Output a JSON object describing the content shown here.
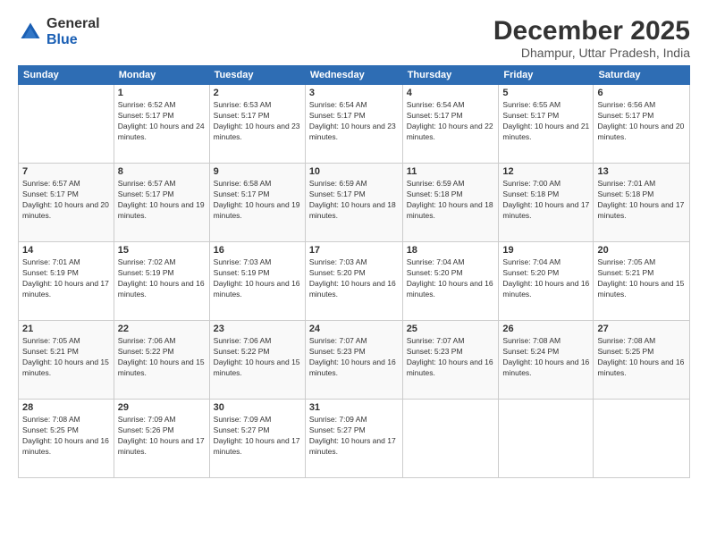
{
  "logo": {
    "general": "General",
    "blue": "Blue"
  },
  "title": "December 2025",
  "subtitle": "Dhampur, Uttar Pradesh, India",
  "days": [
    "Sunday",
    "Monday",
    "Tuesday",
    "Wednesday",
    "Thursday",
    "Friday",
    "Saturday"
  ],
  "weeks": [
    [
      {
        "num": "",
        "sunrise": "",
        "sunset": "",
        "daylight": ""
      },
      {
        "num": "1",
        "sunrise": "Sunrise: 6:52 AM",
        "sunset": "Sunset: 5:17 PM",
        "daylight": "Daylight: 10 hours and 24 minutes."
      },
      {
        "num": "2",
        "sunrise": "Sunrise: 6:53 AM",
        "sunset": "Sunset: 5:17 PM",
        "daylight": "Daylight: 10 hours and 23 minutes."
      },
      {
        "num": "3",
        "sunrise": "Sunrise: 6:54 AM",
        "sunset": "Sunset: 5:17 PM",
        "daylight": "Daylight: 10 hours and 23 minutes."
      },
      {
        "num": "4",
        "sunrise": "Sunrise: 6:54 AM",
        "sunset": "Sunset: 5:17 PM",
        "daylight": "Daylight: 10 hours and 22 minutes."
      },
      {
        "num": "5",
        "sunrise": "Sunrise: 6:55 AM",
        "sunset": "Sunset: 5:17 PM",
        "daylight": "Daylight: 10 hours and 21 minutes."
      },
      {
        "num": "6",
        "sunrise": "Sunrise: 6:56 AM",
        "sunset": "Sunset: 5:17 PM",
        "daylight": "Daylight: 10 hours and 20 minutes."
      }
    ],
    [
      {
        "num": "7",
        "sunrise": "Sunrise: 6:57 AM",
        "sunset": "Sunset: 5:17 PM",
        "daylight": "Daylight: 10 hours and 20 minutes."
      },
      {
        "num": "8",
        "sunrise": "Sunrise: 6:57 AM",
        "sunset": "Sunset: 5:17 PM",
        "daylight": "Daylight: 10 hours and 19 minutes."
      },
      {
        "num": "9",
        "sunrise": "Sunrise: 6:58 AM",
        "sunset": "Sunset: 5:17 PM",
        "daylight": "Daylight: 10 hours and 19 minutes."
      },
      {
        "num": "10",
        "sunrise": "Sunrise: 6:59 AM",
        "sunset": "Sunset: 5:17 PM",
        "daylight": "Daylight: 10 hours and 18 minutes."
      },
      {
        "num": "11",
        "sunrise": "Sunrise: 6:59 AM",
        "sunset": "Sunset: 5:18 PM",
        "daylight": "Daylight: 10 hours and 18 minutes."
      },
      {
        "num": "12",
        "sunrise": "Sunrise: 7:00 AM",
        "sunset": "Sunset: 5:18 PM",
        "daylight": "Daylight: 10 hours and 17 minutes."
      },
      {
        "num": "13",
        "sunrise": "Sunrise: 7:01 AM",
        "sunset": "Sunset: 5:18 PM",
        "daylight": "Daylight: 10 hours and 17 minutes."
      }
    ],
    [
      {
        "num": "14",
        "sunrise": "Sunrise: 7:01 AM",
        "sunset": "Sunset: 5:19 PM",
        "daylight": "Daylight: 10 hours and 17 minutes."
      },
      {
        "num": "15",
        "sunrise": "Sunrise: 7:02 AM",
        "sunset": "Sunset: 5:19 PM",
        "daylight": "Daylight: 10 hours and 16 minutes."
      },
      {
        "num": "16",
        "sunrise": "Sunrise: 7:03 AM",
        "sunset": "Sunset: 5:19 PM",
        "daylight": "Daylight: 10 hours and 16 minutes."
      },
      {
        "num": "17",
        "sunrise": "Sunrise: 7:03 AM",
        "sunset": "Sunset: 5:20 PM",
        "daylight": "Daylight: 10 hours and 16 minutes."
      },
      {
        "num": "18",
        "sunrise": "Sunrise: 7:04 AM",
        "sunset": "Sunset: 5:20 PM",
        "daylight": "Daylight: 10 hours and 16 minutes."
      },
      {
        "num": "19",
        "sunrise": "Sunrise: 7:04 AM",
        "sunset": "Sunset: 5:20 PM",
        "daylight": "Daylight: 10 hours and 16 minutes."
      },
      {
        "num": "20",
        "sunrise": "Sunrise: 7:05 AM",
        "sunset": "Sunset: 5:21 PM",
        "daylight": "Daylight: 10 hours and 15 minutes."
      }
    ],
    [
      {
        "num": "21",
        "sunrise": "Sunrise: 7:05 AM",
        "sunset": "Sunset: 5:21 PM",
        "daylight": "Daylight: 10 hours and 15 minutes."
      },
      {
        "num": "22",
        "sunrise": "Sunrise: 7:06 AM",
        "sunset": "Sunset: 5:22 PM",
        "daylight": "Daylight: 10 hours and 15 minutes."
      },
      {
        "num": "23",
        "sunrise": "Sunrise: 7:06 AM",
        "sunset": "Sunset: 5:22 PM",
        "daylight": "Daylight: 10 hours and 15 minutes."
      },
      {
        "num": "24",
        "sunrise": "Sunrise: 7:07 AM",
        "sunset": "Sunset: 5:23 PM",
        "daylight": "Daylight: 10 hours and 16 minutes."
      },
      {
        "num": "25",
        "sunrise": "Sunrise: 7:07 AM",
        "sunset": "Sunset: 5:23 PM",
        "daylight": "Daylight: 10 hours and 16 minutes."
      },
      {
        "num": "26",
        "sunrise": "Sunrise: 7:08 AM",
        "sunset": "Sunset: 5:24 PM",
        "daylight": "Daylight: 10 hours and 16 minutes."
      },
      {
        "num": "27",
        "sunrise": "Sunrise: 7:08 AM",
        "sunset": "Sunset: 5:25 PM",
        "daylight": "Daylight: 10 hours and 16 minutes."
      }
    ],
    [
      {
        "num": "28",
        "sunrise": "Sunrise: 7:08 AM",
        "sunset": "Sunset: 5:25 PM",
        "daylight": "Daylight: 10 hours and 16 minutes."
      },
      {
        "num": "29",
        "sunrise": "Sunrise: 7:09 AM",
        "sunset": "Sunset: 5:26 PM",
        "daylight": "Daylight: 10 hours and 17 minutes."
      },
      {
        "num": "30",
        "sunrise": "Sunrise: 7:09 AM",
        "sunset": "Sunset: 5:27 PM",
        "daylight": "Daylight: 10 hours and 17 minutes."
      },
      {
        "num": "31",
        "sunrise": "Sunrise: 7:09 AM",
        "sunset": "Sunset: 5:27 PM",
        "daylight": "Daylight: 10 hours and 17 minutes."
      },
      {
        "num": "",
        "sunrise": "",
        "sunset": "",
        "daylight": ""
      },
      {
        "num": "",
        "sunrise": "",
        "sunset": "",
        "daylight": ""
      },
      {
        "num": "",
        "sunrise": "",
        "sunset": "",
        "daylight": ""
      }
    ]
  ]
}
